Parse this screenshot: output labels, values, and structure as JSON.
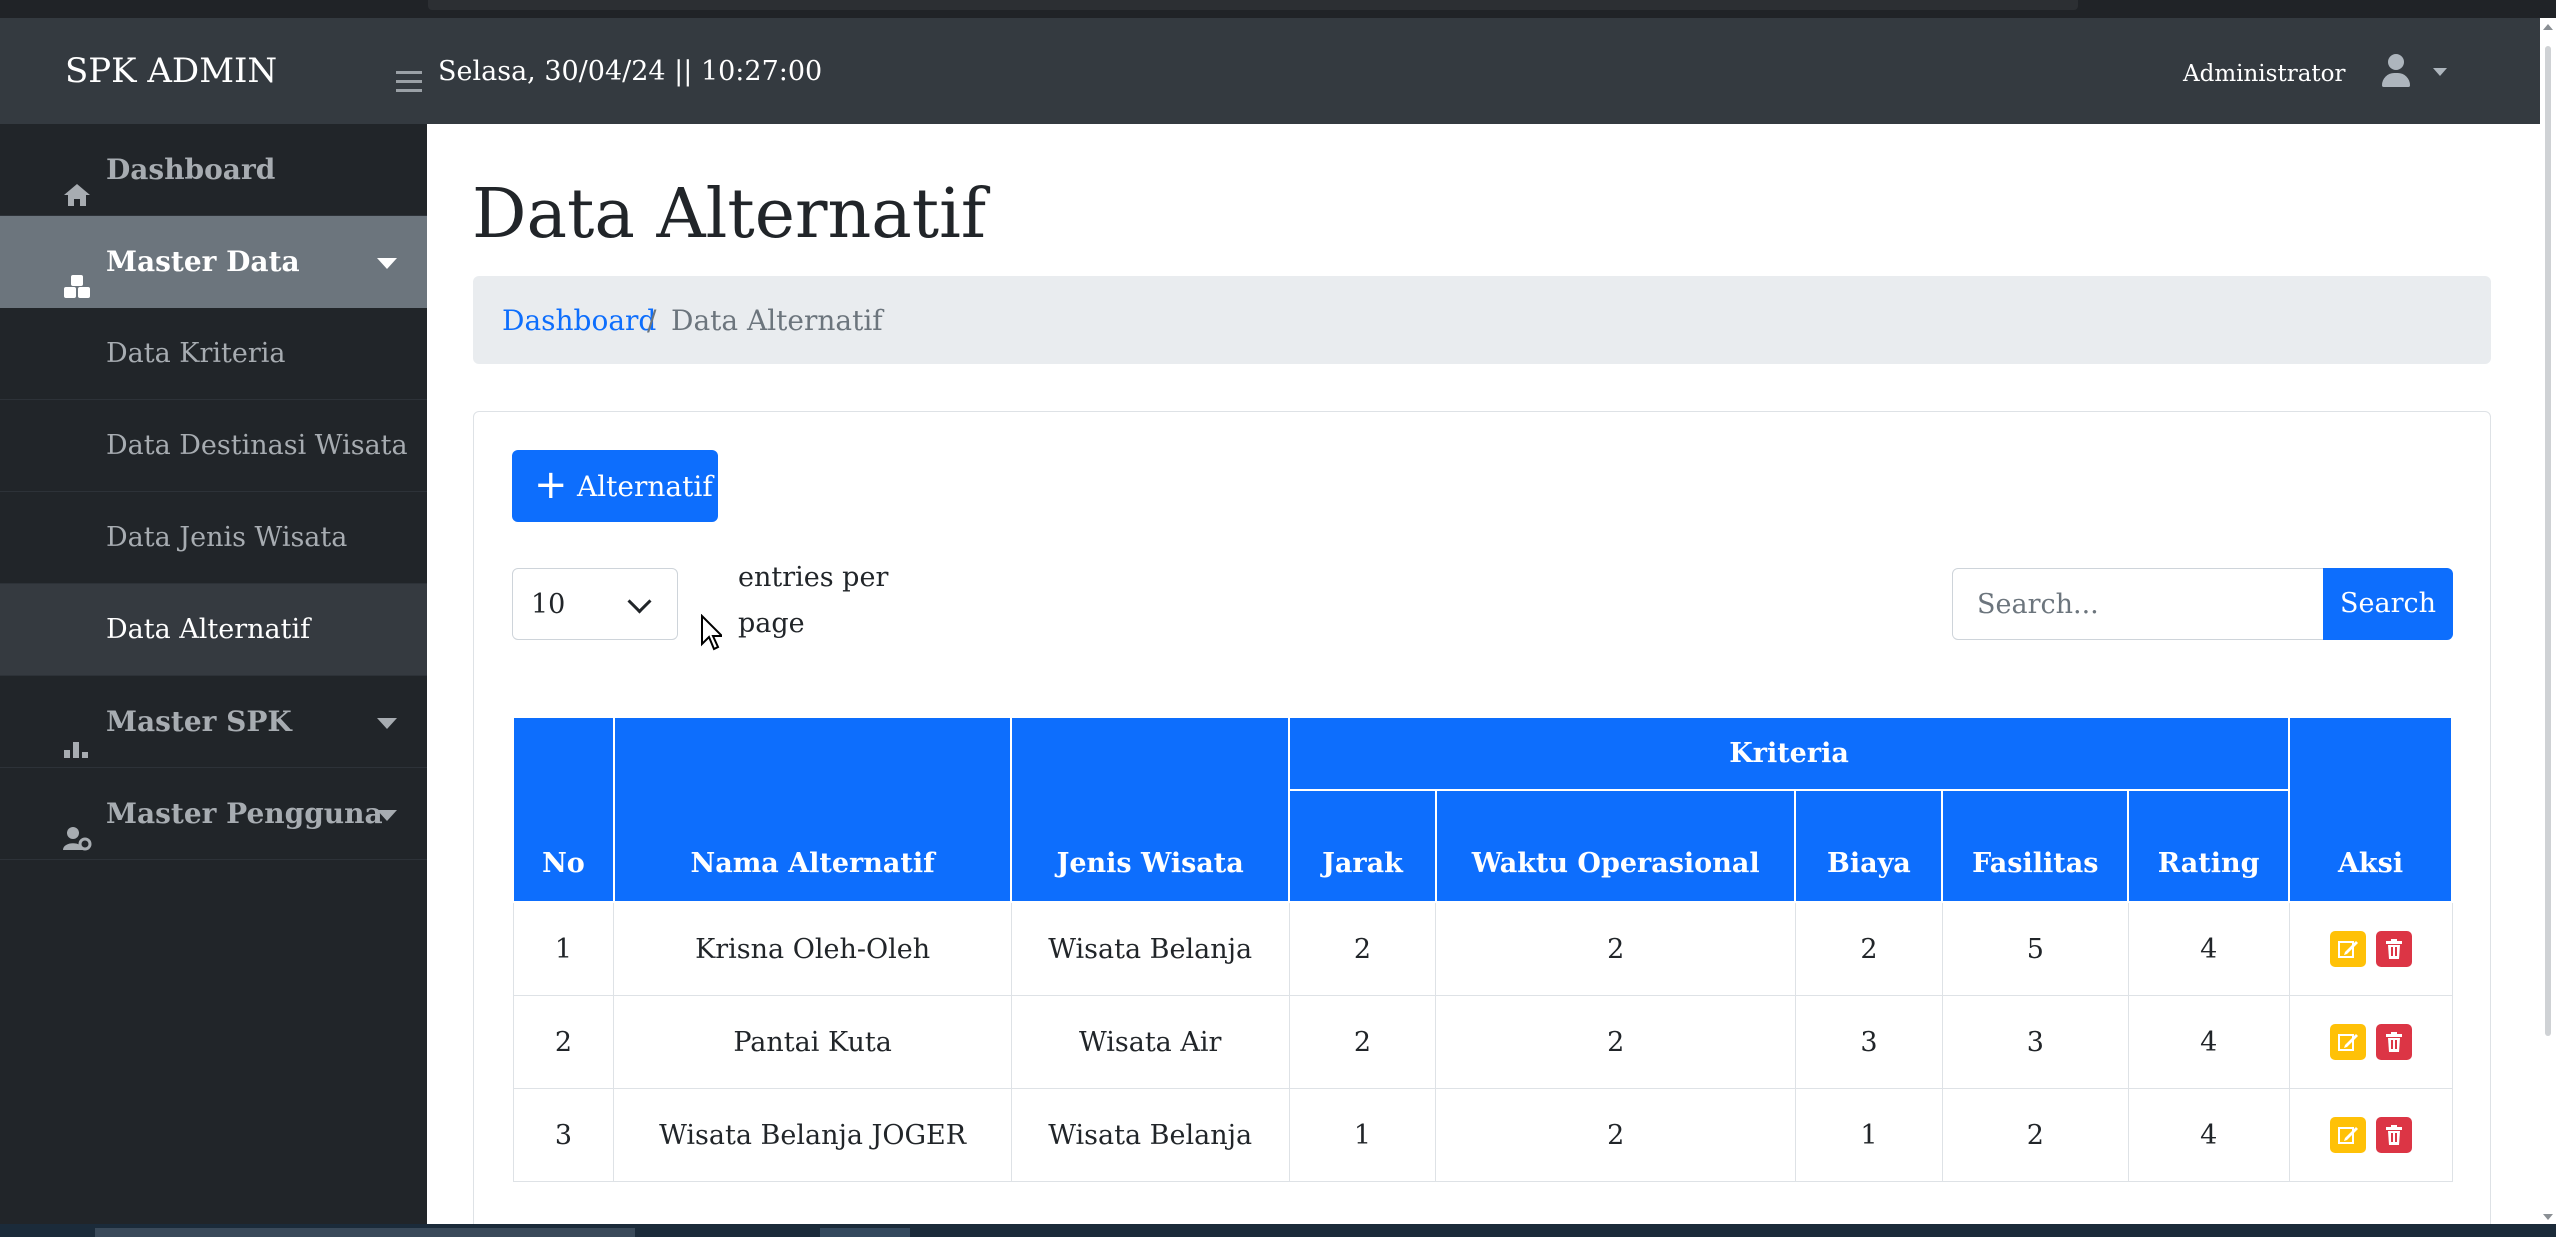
{
  "navbar": {
    "brand": "SPK ADMIN",
    "datetime": "Selasa, 30/04/24 || 10:27:00",
    "user_label": "Administrator"
  },
  "sidebar": {
    "items": [
      {
        "label": "Dashboard",
        "icon": "home-icon"
      },
      {
        "label": "Master Data",
        "icon": "cubes-icon",
        "active": true,
        "children": [
          {
            "label": "Data Kriteria"
          },
          {
            "label": "Data Destinasi Wisata"
          },
          {
            "label": "Data Jenis Wisata"
          },
          {
            "label": "Data Alternatif",
            "current": true
          }
        ]
      },
      {
        "label": "Master SPK",
        "icon": "chart-icon"
      },
      {
        "label": "Master Pengguna",
        "icon": "user-cog-icon"
      }
    ]
  },
  "page": {
    "title": "Data Alternatif",
    "breadcrumb": {
      "home": "Dashboard",
      "separator": "/",
      "current": "Data Alternatif"
    },
    "add_button": "Alternatif",
    "entries": {
      "value": "10",
      "label": "entries per page"
    },
    "search": {
      "placeholder": "Search...",
      "button": "Search"
    }
  },
  "table": {
    "group_header": "Kriteria",
    "headers": {
      "no": "No",
      "name": "Nama Alternatif",
      "type": "Jenis Wisata",
      "criteria": [
        "Jarak",
        "Waktu Operasional",
        "Biaya",
        "Fasilitas",
        "Rating"
      ],
      "actions": "Aksi"
    },
    "rows": [
      {
        "no": "1",
        "name": "Krisna Oleh-Oleh",
        "type": "Wisata Belanja",
        "values": [
          "2",
          "2",
          "2",
          "5",
          "4"
        ]
      },
      {
        "no": "2",
        "name": "Pantai Kuta",
        "type": "Wisata Air",
        "values": [
          "2",
          "2",
          "3",
          "3",
          "4"
        ]
      },
      {
        "no": "3",
        "name": "Wisata Belanja JOGER",
        "type": "Wisata Belanja",
        "values": [
          "1",
          "2",
          "1",
          "2",
          "4"
        ]
      }
    ]
  },
  "colors": {
    "primary": "#0d6efd",
    "warning": "#ffc107",
    "danger": "#dc3545",
    "navbar": "#343a40",
    "sidebar": "#212529",
    "sidebar_active": "#6c757d"
  }
}
